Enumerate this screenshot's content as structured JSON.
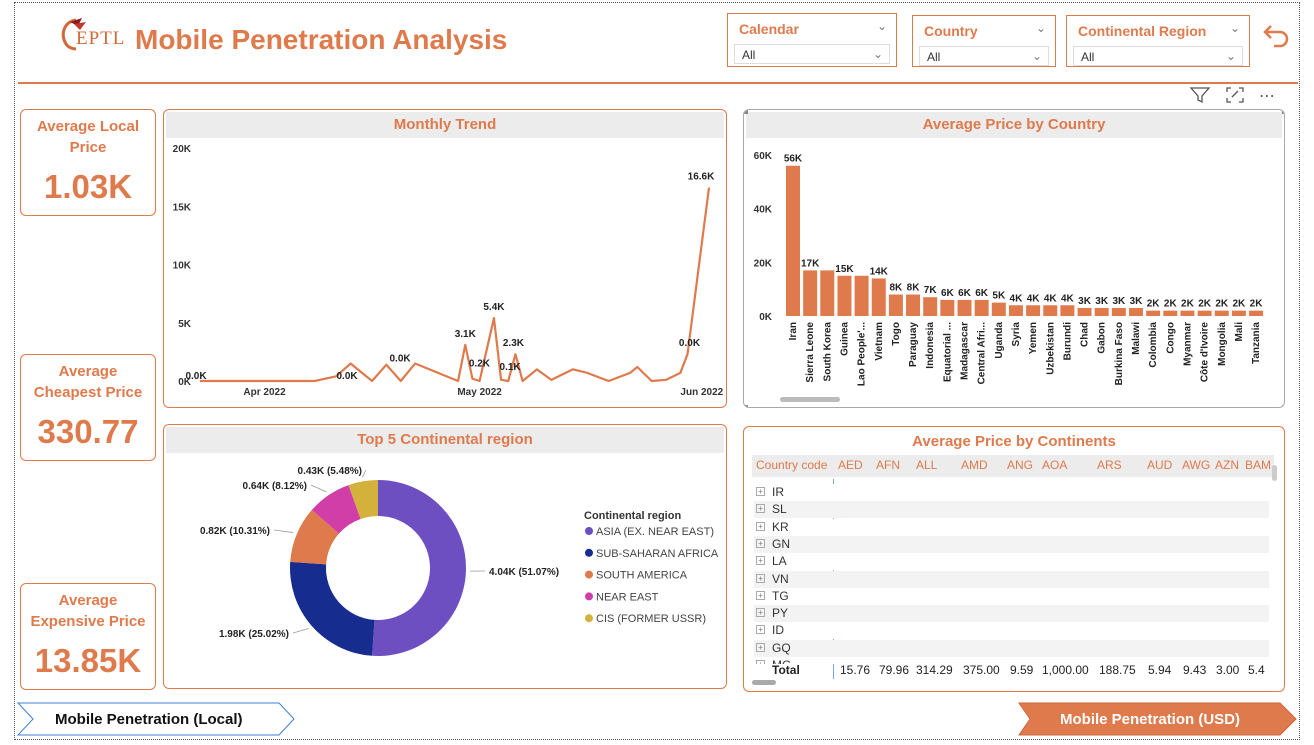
{
  "header": {
    "logo_text": "EPTL",
    "title": "Mobile Penetration Analysis"
  },
  "slicers": [
    {
      "label": "Calendar",
      "value": "All"
    },
    {
      "label": "Country",
      "value": "All"
    },
    {
      "label": "Continental Region",
      "value": "All"
    }
  ],
  "kpis": [
    {
      "title_line1": "Average Local",
      "title_line2": "Price",
      "value": "1.03K"
    },
    {
      "title_line1": "Average",
      "title_line2": "Cheapest Price",
      "value": "330.77"
    },
    {
      "title_line1": "Average",
      "title_line2": "Expensive Price",
      "value": "13.85K"
    }
  ],
  "monthly_trend": {
    "title": "Monthly Trend",
    "y_ticks": [
      "20K",
      "15K",
      "10K",
      "5K",
      "0K"
    ],
    "x_ticks": [
      "Apr 2022",
      "May 2022",
      "Jun 2022"
    ],
    "data_labels": [
      "0.0K",
      "0.0K",
      "0.0K",
      "3.1K",
      "0.2K",
      "5.4K",
      "0.1K",
      "2.3K",
      "0.0K",
      "16.6K"
    ]
  },
  "avg_price_country": {
    "title": "Average Price by Country",
    "y_ticks": [
      "60K",
      "40K",
      "20K",
      "0K"
    ]
  },
  "top5": {
    "title": "Top 5 Continental region",
    "legend_title": "Continental region",
    "slice_labels": [
      "4.04K (51.07%)",
      "1.98K (25.02%)",
      "0.82K (10.31%)",
      "0.64K (8.12%)",
      "0.43K (5.48%)"
    ]
  },
  "continents_table": {
    "title": "Average Price by Continents",
    "columns": [
      "Country code",
      "AED",
      "AFN",
      "ALL",
      "AMD",
      "ANG",
      "AOA",
      "ARS",
      "AUD",
      "AWG",
      "AZN",
      "BAM"
    ],
    "rows": [
      "IR",
      "SL",
      "KR",
      "GN",
      "LA",
      "VN",
      "TG",
      "PY",
      "ID",
      "GQ",
      "MG"
    ],
    "total_label": "Total",
    "totals": [
      "15.76",
      "79.96",
      "314.29",
      "375.00",
      "9.59",
      "1,000.00",
      "188.75",
      "5.94",
      "9.43",
      "3.00",
      "5.4"
    ]
  },
  "nav": {
    "left_label": "Mobile Penetration (Local)",
    "right_label": "Mobile Penetration (USD)"
  },
  "colors": {
    "accent": "#df7a4c",
    "bar": "#df7a4c",
    "line": "#df7a4c"
  },
  "chart_data": [
    {
      "type": "line",
      "title": "Monthly Trend",
      "xlabel": "",
      "ylabel": "",
      "ylim": [
        0,
        20000
      ],
      "x": [
        "2022-03-23",
        "2022-04-01",
        "2022-04-08",
        "2022-04-11",
        "2022-04-13",
        "2022-04-16",
        "2022-04-18",
        "2022-04-20",
        "2022-04-22",
        "2022-04-28",
        "2022-04-29",
        "2022-04-30",
        "2022-05-01",
        "2022-05-03",
        "2022-05-04",
        "2022-05-05",
        "2022-05-06",
        "2022-05-07",
        "2022-05-09",
        "2022-05-11",
        "2022-05-14",
        "2022-05-16",
        "2022-05-19",
        "2022-05-22",
        "2022-05-23",
        "2022-05-25",
        "2022-05-27",
        "2022-05-29",
        "2022-05-30",
        "2022-06-02"
      ],
      "y": [
        0,
        0,
        0,
        400,
        1500,
        0,
        1400,
        0,
        1500,
        0,
        3100,
        200,
        0,
        5400,
        100,
        0,
        2300,
        0,
        1000,
        100,
        1000,
        700,
        0,
        700,
        1200,
        0,
        100,
        700,
        2300,
        16600
      ],
      "labels_shown": [
        "0.0K",
        "0.0K",
        "0.0K",
        "3.1K",
        "0.2K",
        "5.4K",
        "0.1K",
        "2.3K",
        "0.0K",
        "16.6K"
      ]
    },
    {
      "type": "bar",
      "title": "Average Price by Country",
      "ylim": [
        0,
        60000
      ],
      "categories": [
        "Iran",
        "Sierra Leone",
        "South Korea",
        "Guinea",
        "Lao People'...",
        "Vietnam",
        "Togo",
        "Paraguay",
        "Indonesia",
        "Equatorial ...",
        "Madagascar",
        "Central Afri...",
        "Uganda",
        "Syria",
        "Yemen",
        "Uzbekistan",
        "Burundi",
        "Chad",
        "Gabon",
        "Burkina Faso",
        "Malawi",
        "Colombia",
        "Congo",
        "Myanmar",
        "Côte d'Ivoire",
        "Mongolia",
        "Mali",
        "Tanzania"
      ],
      "values": [
        56000,
        17000,
        17000,
        15000,
        15000,
        14000,
        8000,
        8000,
        7000,
        6000,
        6000,
        6000,
        5000,
        4000,
        4000,
        4000,
        4000,
        3000,
        3000,
        3000,
        3000,
        2000,
        2000,
        2000,
        2000,
        2000,
        2000,
        2000
      ],
      "value_labels": [
        "56K",
        "17K",
        "",
        "15K",
        "",
        "14K",
        "8K",
        "8K",
        "7K",
        "6K",
        "6K",
        "6K",
        "5K",
        "4K",
        "4K",
        "4K",
        "4K",
        "3K",
        "3K",
        "3K",
        "3K",
        "2K",
        "2K",
        "2K",
        "2K",
        "2K",
        "2K",
        "2K"
      ]
    },
    {
      "type": "pie",
      "title": "Top 5 Continental region",
      "legend_title": "Continental region",
      "categories": [
        "ASIA (EX. NEAR EAST)",
        "SUB-SAHARAN AFRICA",
        "SOUTH AMERICA",
        "NEAR EAST",
        "CIS (FORMER USSR)"
      ],
      "values": [
        4040,
        1980,
        820,
        640,
        430
      ],
      "percents": [
        51.07,
        25.02,
        10.31,
        8.12,
        5.48
      ],
      "colors": [
        "#6d4fc2",
        "#162c8f",
        "#df7a4c",
        "#d23ea8",
        "#d3b13a"
      ],
      "legend_position": "right"
    }
  ]
}
